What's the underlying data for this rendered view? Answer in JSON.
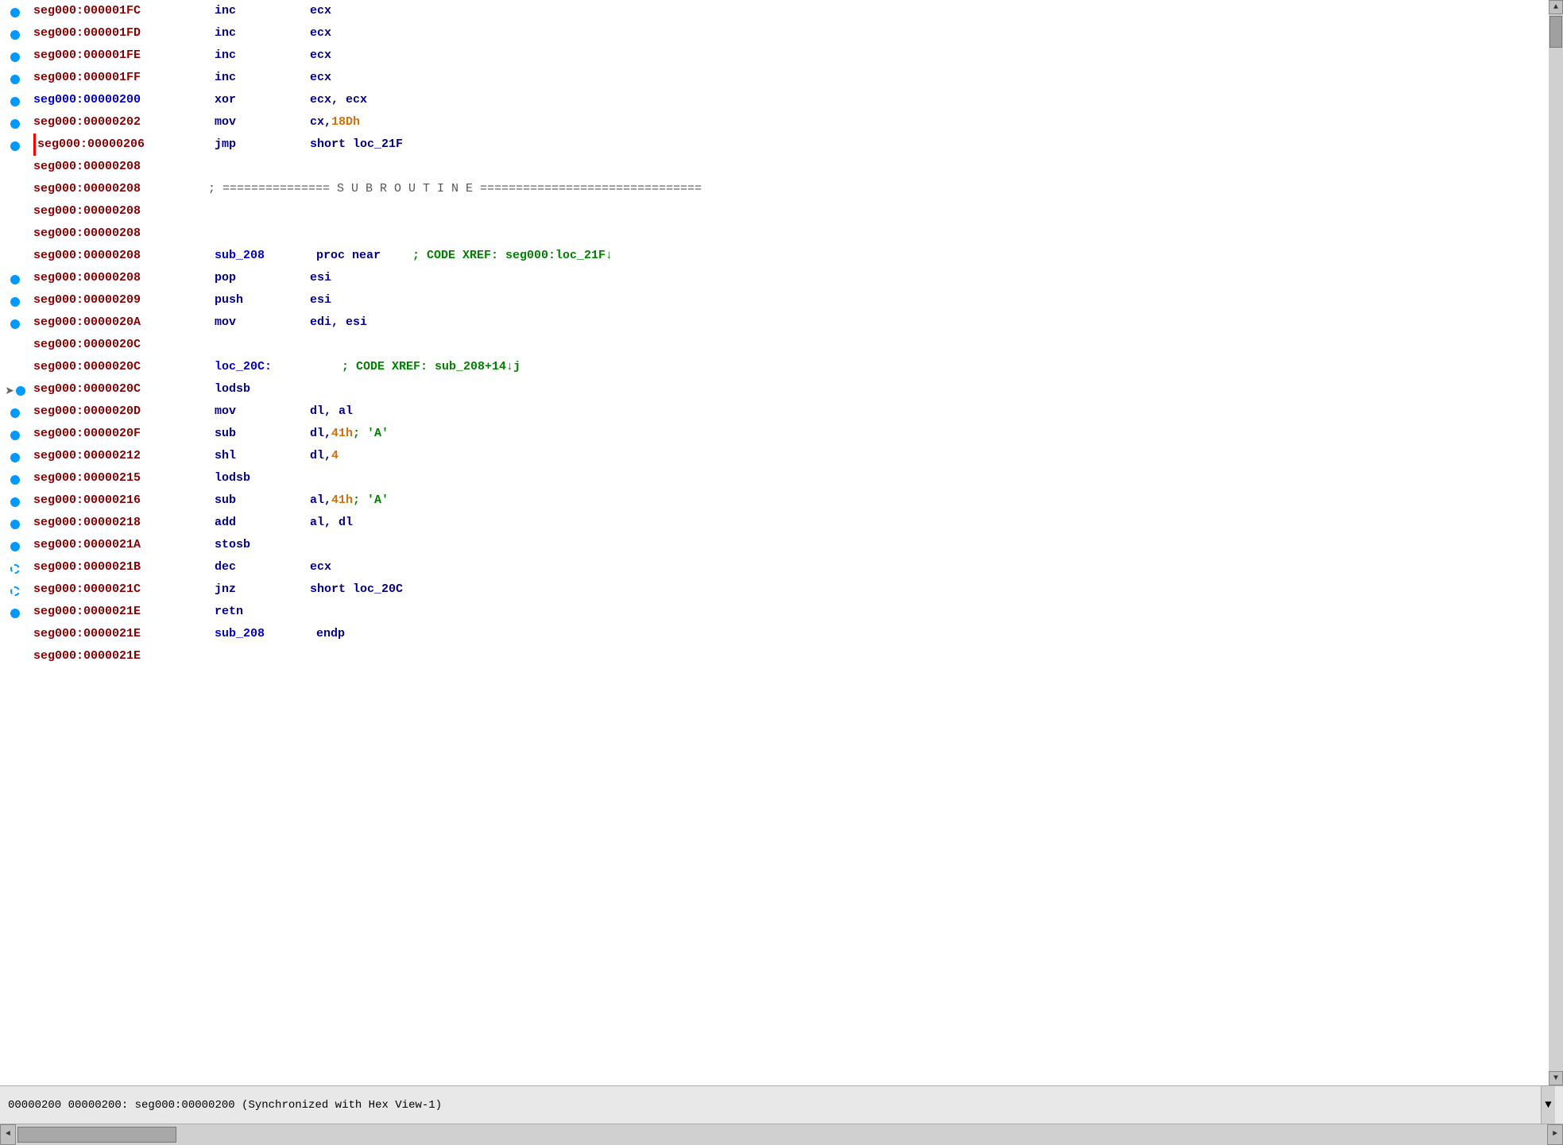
{
  "colors": {
    "addr_dark": "#8b0000",
    "addr_blue": "#0000cd",
    "mnemonic": "#00008b",
    "operand": "#00008b",
    "imm": "#d4700a",
    "comment": "#008000",
    "bg": "#ffffff",
    "statusbar_bg": "#e8e8e8"
  },
  "lines": [
    {
      "addr": "seg000:000001FC",
      "addr_style": "normal",
      "bp": "solid",
      "mnemonic": "inc",
      "operands": [
        {
          "text": "ecx",
          "style": "operand"
        }
      ],
      "comment": ""
    },
    {
      "addr": "seg000:000001FD",
      "addr_style": "normal",
      "bp": "solid",
      "mnemonic": "inc",
      "operands": [
        {
          "text": "ecx",
          "style": "operand"
        }
      ],
      "comment": ""
    },
    {
      "addr": "seg000:000001FE",
      "addr_style": "normal",
      "bp": "solid",
      "mnemonic": "inc",
      "operands": [
        {
          "text": "ecx",
          "style": "operand"
        }
      ],
      "comment": ""
    },
    {
      "addr": "seg000:000001FF",
      "addr_style": "normal",
      "bp": "solid",
      "mnemonic": "inc",
      "operands": [
        {
          "text": "ecx",
          "style": "operand"
        }
      ],
      "comment": ""
    },
    {
      "addr": "seg000:00000200",
      "addr_style": "blue",
      "bp": "solid",
      "mnemonic": "xor",
      "operands": [
        {
          "text": "ecx, ecx",
          "style": "operand"
        }
      ],
      "comment": ""
    },
    {
      "addr": "seg000:00000202",
      "addr_style": "normal",
      "bp": "solid",
      "mnemonic": "mov",
      "operands": [
        {
          "text": "cx, ",
          "style": "operand"
        },
        {
          "text": "18Dh",
          "style": "imm"
        }
      ],
      "comment": ""
    },
    {
      "addr": "seg000:00000206",
      "addr_style": "red-arrow",
      "bp": "solid",
      "mnemonic": "jmp",
      "operands": [
        {
          "text": "short loc_21F",
          "style": "operand"
        }
      ],
      "comment": ""
    },
    {
      "addr": "seg000:00000208",
      "addr_style": "normal",
      "bp": "none",
      "mnemonic": "",
      "operands": [],
      "comment": ""
    },
    {
      "addr": "seg000:00000208",
      "addr_style": "normal",
      "bp": "none",
      "mnemonic": "",
      "operands": [
        {
          "text": "; =============== S U B R O U T I N E ===============================",
          "style": "separator"
        }
      ],
      "comment": ""
    },
    {
      "addr": "seg000:00000208",
      "addr_style": "normal",
      "bp": "none",
      "mnemonic": "",
      "operands": [],
      "comment": ""
    },
    {
      "addr": "seg000:00000208",
      "addr_style": "normal",
      "bp": "none",
      "mnemonic": "",
      "operands": [],
      "comment": ""
    },
    {
      "addr": "seg000:00000208",
      "addr_style": "normal",
      "bp": "none",
      "label": "sub_208",
      "mnemonic": "proc near",
      "operands": [],
      "comment": "; CODE XREF: seg000:loc_21F↓"
    },
    {
      "addr": "seg000:00000208",
      "addr_style": "normal",
      "bp": "solid",
      "mnemonic": "pop",
      "operands": [
        {
          "text": "esi",
          "style": "operand"
        }
      ],
      "comment": ""
    },
    {
      "addr": "seg000:00000209",
      "addr_style": "normal",
      "bp": "solid",
      "mnemonic": "push",
      "operands": [
        {
          "text": "esi",
          "style": "operand"
        }
      ],
      "comment": ""
    },
    {
      "addr": "seg000:0000020A",
      "addr_style": "normal",
      "bp": "solid",
      "mnemonic": "mov",
      "operands": [
        {
          "text": "edi, esi",
          "style": "operand"
        }
      ],
      "comment": ""
    },
    {
      "addr": "seg000:0000020C",
      "addr_style": "normal",
      "bp": "none",
      "mnemonic": "",
      "operands": [],
      "comment": ""
    },
    {
      "addr": "seg000:0000020C",
      "addr_style": "normal",
      "bp": "none",
      "label": "loc_20C:",
      "mnemonic": "",
      "operands": [],
      "comment": "; CODE XREF: sub_208+14↓j"
    },
    {
      "addr": "seg000:0000020C",
      "addr_style": "normal",
      "bp": "arrow-solid",
      "mnemonic": "lodsb",
      "operands": [],
      "comment": ""
    },
    {
      "addr": "seg000:0000020D",
      "addr_style": "normal",
      "bp": "solid",
      "mnemonic": "mov",
      "operands": [
        {
          "text": "dl, al",
          "style": "operand"
        }
      ],
      "comment": ""
    },
    {
      "addr": "seg000:0000020F",
      "addr_style": "normal",
      "bp": "solid",
      "mnemonic": "sub",
      "operands": [
        {
          "text": "dl, ",
          "style": "operand"
        },
        {
          "text": "41h",
          "style": "imm"
        },
        {
          "text": " ; 'A'",
          "style": "comment"
        }
      ],
      "comment": ""
    },
    {
      "addr": "seg000:00000212",
      "addr_style": "normal",
      "bp": "solid",
      "mnemonic": "shl",
      "operands": [
        {
          "text": "dl, ",
          "style": "operand"
        },
        {
          "text": "4",
          "style": "imm"
        }
      ],
      "comment": ""
    },
    {
      "addr": "seg000:00000215",
      "addr_style": "normal",
      "bp": "solid",
      "mnemonic": "lodsb",
      "operands": [],
      "comment": ""
    },
    {
      "addr": "seg000:00000216",
      "addr_style": "normal",
      "bp": "solid",
      "mnemonic": "sub",
      "operands": [
        {
          "text": "al, ",
          "style": "operand"
        },
        {
          "text": "41h",
          "style": "imm"
        },
        {
          "text": " ; 'A'",
          "style": "comment"
        }
      ],
      "comment": ""
    },
    {
      "addr": "seg000:00000218",
      "addr_style": "normal",
      "bp": "solid",
      "mnemonic": "add",
      "operands": [
        {
          "text": "al, dl",
          "style": "operand"
        }
      ],
      "comment": ""
    },
    {
      "addr": "seg000:0000021A",
      "addr_style": "normal",
      "bp": "solid",
      "mnemonic": "stosb",
      "operands": [],
      "comment": ""
    },
    {
      "addr": "seg000:0000021B",
      "addr_style": "normal",
      "bp": "dashed",
      "mnemonic": "dec",
      "operands": [
        {
          "text": "ecx",
          "style": "operand"
        }
      ],
      "comment": ""
    },
    {
      "addr": "seg000:0000021C",
      "addr_style": "normal",
      "bp": "dashed",
      "mnemonic": "jnz",
      "operands": [
        {
          "text": "short loc_20C",
          "style": "operand"
        }
      ],
      "comment": ""
    },
    {
      "addr": "seg000:0000021E",
      "addr_style": "normal",
      "bp": "solid",
      "mnemonic": "retn",
      "operands": [],
      "comment": ""
    },
    {
      "addr": "seg000:0000021E",
      "addr_style": "normal",
      "bp": "none",
      "label": "sub_208",
      "mnemonic": "endp",
      "operands": [],
      "comment": ""
    },
    {
      "addr": "seg000:0000021E",
      "addr_style": "normal",
      "bp": "none",
      "mnemonic": "",
      "operands": [],
      "comment": ""
    }
  ],
  "status": {
    "text": "00000200  00000200: seg000:00000200 (Synchronized with Hex View-1)"
  },
  "scrollbar": {
    "up_arrow": "▲",
    "down_arrow": "▼",
    "left_arrow": "◄",
    "right_arrow": "►"
  }
}
